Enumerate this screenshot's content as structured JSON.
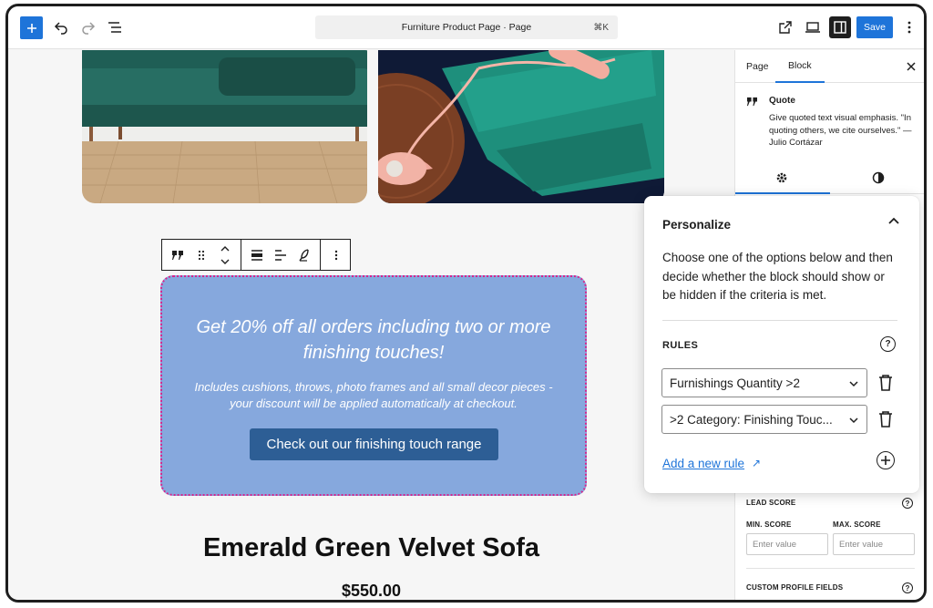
{
  "topbar": {
    "add_icon": "plus-icon",
    "undo_icon": "undo-icon",
    "redo_icon": "redo-icon",
    "list_view_icon": "list-view-icon",
    "document_title": "Furniture Product Page · Page",
    "shortcut": "⌘K",
    "view_icon": "external-link-icon",
    "preview_icon": "desktop-preview-icon",
    "settings_icon": "sidebar-toggle-icon",
    "save_label": "Save",
    "options_icon": "more-vertical-icon"
  },
  "canvas": {
    "image1_alt": "green velvet sofa on wooden floor",
    "image2_alt": "green velvet sofa with pink telephone",
    "block_toolbar": {
      "icons": [
        "quote-icon",
        "drag-handle-icon",
        "move-up-down-icon",
        "align-icon",
        "text-align-left-icon",
        "highlight-icon",
        "more-vertical-icon"
      ]
    },
    "promo": {
      "headline": "Get 20% off all orders including two or more finishing touches!",
      "subtext": "Includes cushions, throws, photo frames and all small decor pieces - your discount will be applied automatically at checkout.",
      "button": "Check out our finishing touch range"
    },
    "product_title": "Emerald Green Velvet Sofa",
    "product_price": "$550.00"
  },
  "sidebar": {
    "tabs": [
      "Page",
      "Block"
    ],
    "active_tab": "Block",
    "block_name": "Quote",
    "block_description": "Give quoted text visual emphasis. \"In quoting others, we cite ourselves.\" — Julio Cortázar",
    "lead_score_label": "LEAD SCORE",
    "min_score_label": "MIN. SCORE",
    "max_score_label": "MAX. SCORE",
    "min_placeholder": "Enter value",
    "max_placeholder": "Enter value",
    "custom_fields_label": "CUSTOM PROFILE FIELDS"
  },
  "personalize": {
    "title": "Personalize",
    "description": "Choose one of the options below and then decide whether the block should show or be hidden if the criteria is met.",
    "rules_label": "RULES",
    "rules": [
      "Furnishings Quantity >2",
      ">2 Category: Finishing Touc..."
    ],
    "add_rule": "Add a new rule",
    "add_rule_icon": "arrow-up-right-icon"
  },
  "colors": {
    "accent": "#1e74d9",
    "promo_bg": "#86a8dd",
    "promo_button": "#2d5e95",
    "selection_outline": "#d6248c"
  }
}
